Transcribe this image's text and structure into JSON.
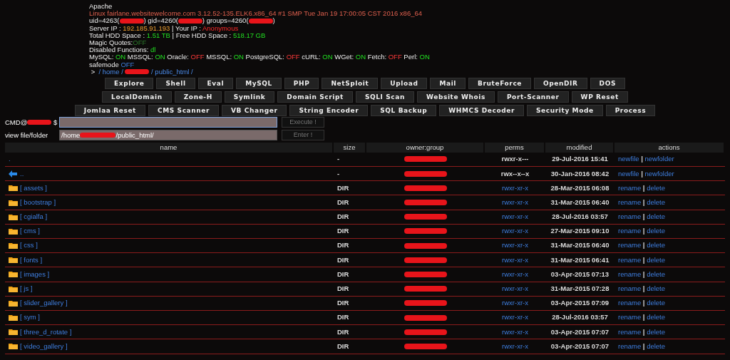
{
  "info_lines": [
    [
      {
        "text": "Apache",
        "kind": "plain"
      }
    ],
    [
      {
        "text": "Linux fairlane.websitewelcome.com 3.12.52-135.ELK6.x86_64 #1 SMP Tue Jan 19 17:00:05 CST 2016 x86_64",
        "kind": "host"
      }
    ],
    [
      {
        "text": "uid=4263(",
        "kind": "plain"
      },
      {
        "kind": "redacted"
      },
      {
        "text": ") gid=4260(",
        "kind": "plain"
      },
      {
        "kind": "redacted"
      },
      {
        "text": ") groups=4260(",
        "kind": "plain"
      },
      {
        "kind": "redacted"
      },
      {
        "text": ")",
        "kind": "plain"
      }
    ],
    [
      {
        "text": "Server IP : ",
        "kind": "plain"
      },
      {
        "text": "192.185.91.193",
        "kind": "value"
      },
      {
        "text": " | Your IP : ",
        "kind": "plain"
      },
      {
        "text": "Anonymous",
        "kind": "alert"
      }
    ],
    [
      {
        "text": "Total HDD Space : ",
        "kind": "plain"
      },
      {
        "text": "1.51 TB",
        "kind": "on"
      },
      {
        "text": " | Free HDD Space : ",
        "kind": "plain"
      },
      {
        "text": "518.17 GB",
        "kind": "on"
      }
    ],
    [
      {
        "text": "Magic Quotes:",
        "kind": "plain"
      },
      {
        "text": "OFF",
        "kind": "dim"
      }
    ],
    [
      {
        "text": "Disabled Functions: ",
        "kind": "plain"
      },
      {
        "text": "dl",
        "kind": "on"
      }
    ],
    [
      {
        "text": "MySQL: ",
        "kind": "plain"
      },
      {
        "text": "ON",
        "kind": "on"
      },
      {
        "text": " MSSQL: ",
        "kind": "plain"
      },
      {
        "text": "ON",
        "kind": "on"
      },
      {
        "text": " Oracle: ",
        "kind": "plain"
      },
      {
        "text": "OFF",
        "kind": "off"
      },
      {
        "text": " MSSQL: ",
        "kind": "plain"
      },
      {
        "text": "ON",
        "kind": "on"
      },
      {
        "text": " PostgreSQL: ",
        "kind": "plain"
      },
      {
        "text": "OFF",
        "kind": "off"
      },
      {
        "text": " cURL: ",
        "kind": "plain"
      },
      {
        "text": "ON",
        "kind": "on"
      },
      {
        "text": " WGet: ",
        "kind": "plain"
      },
      {
        "text": "ON",
        "kind": "on"
      },
      {
        "text": " Fetch: ",
        "kind": "plain"
      },
      {
        "text": "OFF",
        "kind": "off"
      },
      {
        "text": " Perl: ",
        "kind": "plain"
      },
      {
        "text": "ON",
        "kind": "on"
      }
    ],
    [
      {
        "text": "safemode ",
        "kind": "plain"
      },
      {
        "text": "OFF",
        "kind": "blue"
      }
    ]
  ],
  "path": [
    {
      "text": " > ",
      "kind": "plain"
    },
    {
      "text": " / home / ",
      "kind": "path"
    },
    {
      "kind": "redacted"
    },
    {
      "text": " / public_html /",
      "kind": "path"
    }
  ],
  "menu_rows": [
    [
      "Explore",
      "Shell",
      "Eval",
      "MySQL",
      "PHP",
      "NetSploit",
      "Upload",
      "Mail",
      "BruteForce",
      "OpenDIR",
      "DOS"
    ],
    [
      "LocalDomain",
      "Zone-H",
      "Symlink",
      "Domain Script",
      "SQLI Scan",
      "Website Whois",
      "Port-Scanner",
      "WP Reset"
    ],
    [
      "Jomlaa Reset",
      "CMS Scanner",
      "VB Changer",
      "String Encoder",
      "SQL Backup",
      "WHMCS Decoder",
      "Security Mode",
      "Process"
    ]
  ],
  "cmd": {
    "prefix": "CMD@",
    "suffix": "$",
    "button": "Execute !"
  },
  "view": {
    "label": "view file/folder",
    "value_start": "/home",
    "value_end": "/public_html/",
    "button": "Enter !"
  },
  "table": {
    "columns": [
      "name",
      "size",
      "owner:group",
      "perms",
      "modified",
      "actions"
    ],
    "rows": [
      {
        "kind": "current",
        "name": ".",
        "size": "-",
        "perms": "rwxr-x---",
        "perms_link": false,
        "modified": "29-Jul-2016 15:41",
        "actions": [
          "newfile",
          "newfolder"
        ],
        "separator": "|"
      },
      {
        "kind": "up",
        "name": "..",
        "size": "-",
        "perms": "rwx--x--x",
        "perms_link": false,
        "modified": "30-Jan-2016 08:42",
        "actions": [
          "newfile",
          "newfolder"
        ],
        "separator": "|"
      },
      {
        "kind": "dir",
        "name": "[ assets ]",
        "size": "DIR",
        "perms": "rwxr-xr-x",
        "perms_link": true,
        "modified": "28-Mar-2015 06:08",
        "actions": [
          "rename",
          "delete"
        ],
        "separator": "|"
      },
      {
        "kind": "dir",
        "name": "[ bootstrap ]",
        "size": "DIR",
        "perms": "rwxr-xr-x",
        "perms_link": true,
        "modified": "31-Mar-2015 06:40",
        "actions": [
          "rename",
          "delete"
        ],
        "separator": "|"
      },
      {
        "kind": "dir",
        "name": "[ cgialfa ]",
        "size": "DIR",
        "perms": "rwxr-xr-x",
        "perms_link": true,
        "modified": "28-Jul-2016 03:57",
        "actions": [
          "rename",
          "delete"
        ],
        "separator": "|"
      },
      {
        "kind": "dir",
        "name": "[ cms ]",
        "size": "DIR",
        "perms": "rwxr-xr-x",
        "perms_link": true,
        "modified": "27-Mar-2015 09:10",
        "actions": [
          "rename",
          "delete"
        ],
        "separator": "|"
      },
      {
        "kind": "dir",
        "name": "[ css ]",
        "size": "DIR",
        "perms": "rwxr-xr-x",
        "perms_link": true,
        "modified": "31-Mar-2015 06:40",
        "actions": [
          "rename",
          "delete"
        ],
        "separator": "|"
      },
      {
        "kind": "dir",
        "name": "[ fonts ]",
        "size": "DIR",
        "perms": "rwxr-xr-x",
        "perms_link": true,
        "modified": "31-Mar-2015 06:41",
        "actions": [
          "rename",
          "delete"
        ],
        "separator": "|"
      },
      {
        "kind": "dir",
        "name": "[ images ]",
        "size": "DIR",
        "perms": "rwxr-xr-x",
        "perms_link": true,
        "modified": "03-Apr-2015 07:13",
        "actions": [
          "rename",
          "delete"
        ],
        "separator": "|"
      },
      {
        "kind": "dir",
        "name": "[ js ]",
        "size": "DIR",
        "perms": "rwxr-xr-x",
        "perms_link": true,
        "modified": "31-Mar-2015 07:28",
        "actions": [
          "rename",
          "delete"
        ],
        "separator": "|"
      },
      {
        "kind": "dir",
        "name": "[ slider_gallery ]",
        "size": "DIR",
        "perms": "rwxr-xr-x",
        "perms_link": true,
        "modified": "03-Apr-2015 07:09",
        "actions": [
          "rename",
          "delete"
        ],
        "separator": "|"
      },
      {
        "kind": "dir",
        "name": "[ sym ]",
        "size": "DIR",
        "perms": "rwxr-xr-x",
        "perms_link": true,
        "modified": "28-Jul-2016 03:57",
        "actions": [
          "rename",
          "delete"
        ],
        "separator": "|"
      },
      {
        "kind": "dir",
        "name": "[ three_d_rotate ]",
        "size": "DIR",
        "perms": "rwxr-xr-x",
        "perms_link": true,
        "modified": "03-Apr-2015 07:07",
        "actions": [
          "rename",
          "delete"
        ],
        "separator": "|"
      },
      {
        "kind": "dir",
        "name": "[ video_gallery ]",
        "size": "DIR",
        "perms": "rwxr-xr-x",
        "perms_link": true,
        "modified": "03-Apr-2015 07:07",
        "actions": [
          "rename",
          "delete"
        ],
        "separator": "|"
      }
    ]
  }
}
